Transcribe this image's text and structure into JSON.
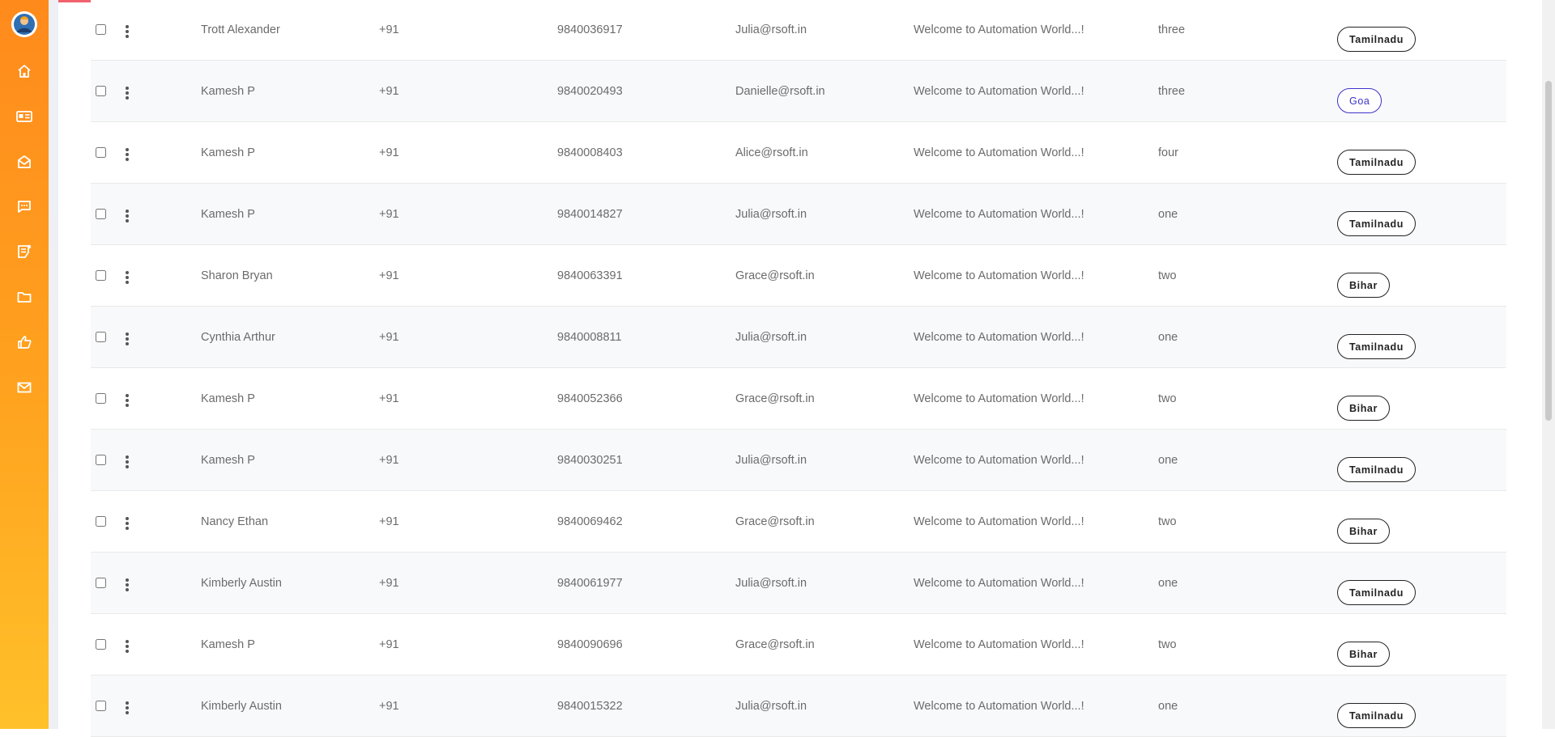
{
  "sidebar": {
    "nav": [
      {
        "icon": "home-icon"
      },
      {
        "icon": "contact-card-icon"
      },
      {
        "icon": "mail-open-icon"
      },
      {
        "icon": "chat-icon"
      },
      {
        "icon": "notes-icon"
      },
      {
        "icon": "folder-icon"
      },
      {
        "icon": "thumbs-up-icon"
      },
      {
        "icon": "mail-icon"
      }
    ]
  },
  "table": {
    "rows": [
      {
        "name": "Trott Alexander",
        "code": "+91",
        "phone": "9840036917",
        "email": "Julia@rsoft.in",
        "message": "Welcome to Automation World...!",
        "count": "three",
        "state": "Tamilnadu"
      },
      {
        "name": "Kamesh P",
        "code": "+91",
        "phone": "9840020493",
        "email": "Danielle@rsoft.in",
        "message": "Welcome to Automation World...!",
        "count": "three",
        "state": "Goa"
      },
      {
        "name": "Kamesh P",
        "code": "+91",
        "phone": "9840008403",
        "email": "Alice@rsoft.in",
        "message": "Welcome to Automation World...!",
        "count": "four",
        "state": "Tamilnadu"
      },
      {
        "name": "Kamesh P",
        "code": "+91",
        "phone": "9840014827",
        "email": "Julia@rsoft.in",
        "message": "Welcome to Automation World...!",
        "count": "one",
        "state": "Tamilnadu"
      },
      {
        "name": "Sharon Bryan",
        "code": "+91",
        "phone": "9840063391",
        "email": "Grace@rsoft.in",
        "message": "Welcome to Automation World...!",
        "count": "two",
        "state": "Bihar"
      },
      {
        "name": "Cynthia Arthur",
        "code": "+91",
        "phone": "9840008811",
        "email": "Julia@rsoft.in",
        "message": "Welcome to Automation World...!",
        "count": "one",
        "state": "Tamilnadu"
      },
      {
        "name": "Kamesh P",
        "code": "+91",
        "phone": "9840052366",
        "email": "Grace@rsoft.in",
        "message": "Welcome to Automation World...!",
        "count": "two",
        "state": "Bihar"
      },
      {
        "name": "Kamesh P",
        "code": "+91",
        "phone": "9840030251",
        "email": "Julia@rsoft.in",
        "message": "Welcome to Automation World...!",
        "count": "one",
        "state": "Tamilnadu"
      },
      {
        "name": "Nancy Ethan",
        "code": "+91",
        "phone": "9840069462",
        "email": "Grace@rsoft.in",
        "message": "Welcome to Automation World...!",
        "count": "two",
        "state": "Bihar"
      },
      {
        "name": "Kimberly Austin",
        "code": "+91",
        "phone": "9840061977",
        "email": "Julia@rsoft.in",
        "message": "Welcome to Automation World...!",
        "count": "one",
        "state": "Tamilnadu"
      },
      {
        "name": "Kamesh P",
        "code": "+91",
        "phone": "9840090696",
        "email": "Grace@rsoft.in",
        "message": "Welcome to Automation World...!",
        "count": "two",
        "state": "Bihar"
      },
      {
        "name": "Kimberly Austin",
        "code": "+91",
        "phone": "9840015322",
        "email": "Julia@rsoft.in",
        "message": "Welcome to Automation World...!",
        "count": "one",
        "state": "Tamilnadu"
      }
    ]
  }
}
